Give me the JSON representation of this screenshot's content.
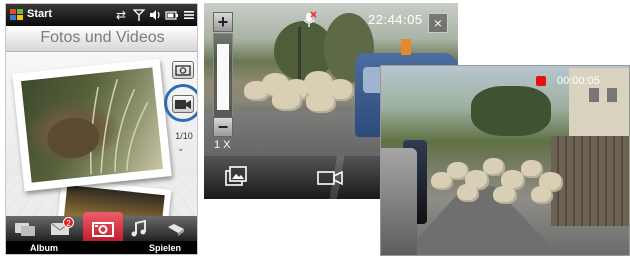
{
  "home": {
    "statusbar": {
      "start_label": "Start",
      "icons": [
        "sync-icon",
        "signal-icon",
        "speaker-icon",
        "battery-icon",
        "menu-icon"
      ]
    },
    "title": "Fotos und Videos",
    "counter": "1/10",
    "tabs": [
      {
        "icon": "messaging-icon",
        "badge": ""
      },
      {
        "icon": "mail-icon",
        "badge": "2"
      },
      {
        "icon": "camera-icon",
        "active": true
      },
      {
        "icon": "music-icon"
      },
      {
        "icon": "speaker-settings-icon"
      }
    ],
    "softkeys": {
      "left": "Album",
      "right": "Spielen"
    },
    "colors": {
      "accent": "#d2283a",
      "highlight_ring": "#2c6bb5"
    }
  },
  "camera": {
    "time": "22:44:05",
    "zoom_label": "1 X",
    "zoom_plus": "+",
    "zoom_minus": "−",
    "close_label": "×"
  },
  "recording": {
    "time": "00:00:05",
    "indicator_color": "#e31313"
  }
}
